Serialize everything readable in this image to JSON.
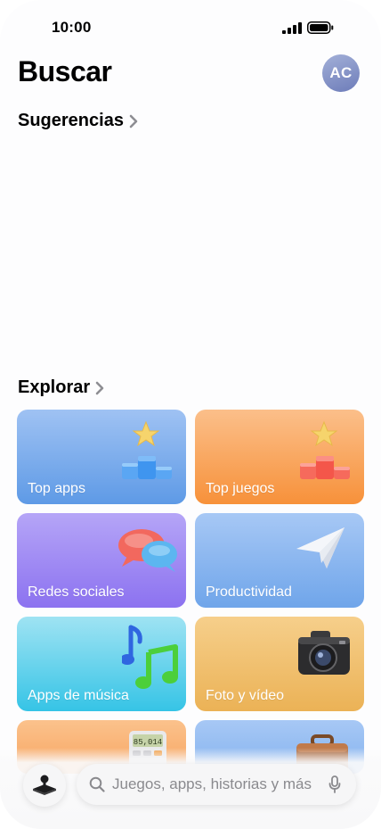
{
  "status_bar": {
    "time": "10:00"
  },
  "header": {
    "title": "Buscar",
    "avatar_initials": "AC"
  },
  "sections": {
    "suggestions": {
      "label": "Sugerencias"
    },
    "explore": {
      "label": "Explorar"
    }
  },
  "categories": [
    {
      "label": "Top apps",
      "icon": "podium-star-blue-icon"
    },
    {
      "label": "Top juegos",
      "icon": "podium-star-red-icon"
    },
    {
      "label": "Redes sociales",
      "icon": "speech-bubbles-icon"
    },
    {
      "label": "Productividad",
      "icon": "paper-plane-icon"
    },
    {
      "label": "Apps de música",
      "icon": "music-notes-icon"
    },
    {
      "label": "Foto y vídeo",
      "icon": "camera-icon"
    },
    {
      "label": "",
      "icon": "calculator-icon",
      "display_value": "85,014"
    },
    {
      "label": "",
      "icon": "briefcase-icon"
    }
  ],
  "search": {
    "placeholder": "Juegos, apps, historias y más"
  },
  "colors": {
    "top_apps": "#5e9ae6",
    "top_games": "#f7913a",
    "social": "#8c72f0",
    "productivity": "#6fa5ea",
    "music": "#36c4e6",
    "photo": "#ebb256"
  }
}
